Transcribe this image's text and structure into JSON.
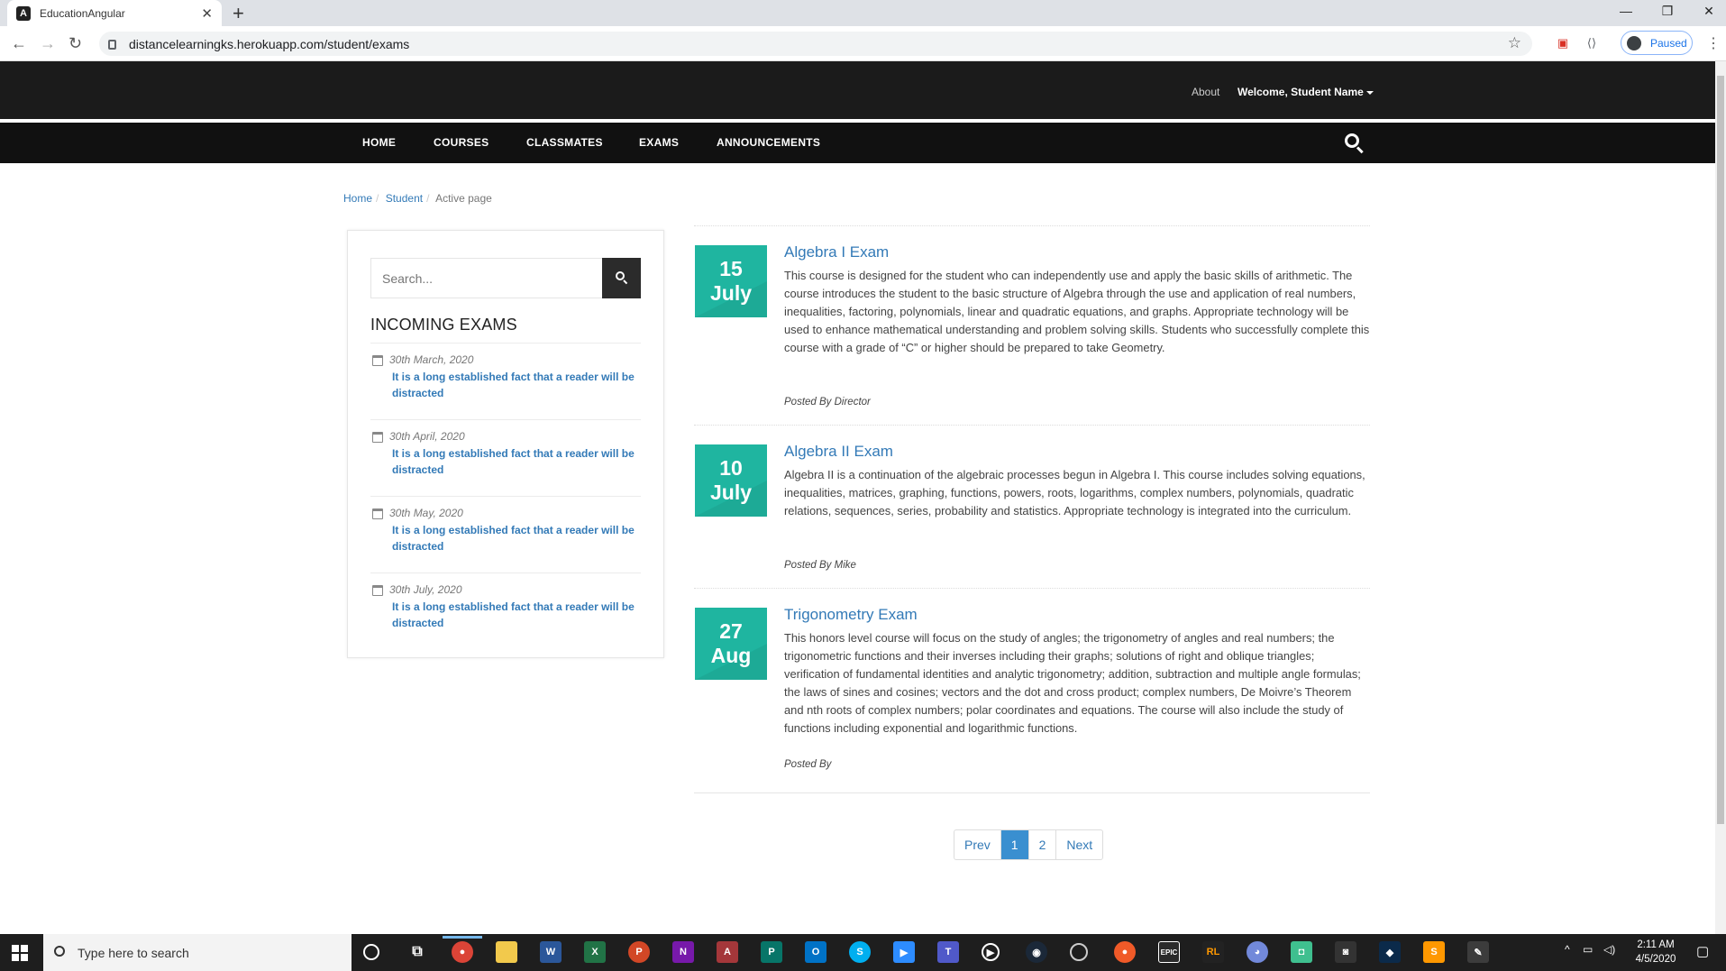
{
  "browser": {
    "tab_title": "EducationAngular",
    "favicon_letter": "A",
    "url": "distancelearningks.herokuapp.com/student/exams",
    "profile_status": "Paused"
  },
  "header": {
    "about_label": "About",
    "welcome_label": "Welcome, Student Name"
  },
  "nav": {
    "items": [
      "HOME",
      "COURSES",
      "CLASSMATES",
      "EXAMS",
      "ANNOUNCEMENTS"
    ]
  },
  "breadcrumb": {
    "home": "Home",
    "student": "Student",
    "active": "Active page"
  },
  "sidebar": {
    "search_placeholder": "Search...",
    "heading": "INCOMING EXAMS",
    "items": [
      {
        "date": "30th March, 2020",
        "text": "It is a long established fact that a reader will be distracted"
      },
      {
        "date": "30th April, 2020",
        "text": "It is a long established fact that a reader will be distracted"
      },
      {
        "date": "30th May, 2020",
        "text": "It is a long established fact that a reader will be distracted"
      },
      {
        "date": "30th July, 2020",
        "text": "It is a long established fact that a reader will be distracted"
      }
    ]
  },
  "exams": [
    {
      "day": "15",
      "month": "July",
      "title": "Algebra I Exam",
      "description": "This course is designed for the student who can independently use and apply the basic skills of arithmetic. The course introduces the student to the basic structure of Algebra through the use and application of real numbers, inequalities, factoring, polynomials, linear and quadratic equations, and graphs. Appropriate technology will be used to enhance mathematical understanding and problem solving skills. Students who successfully complete this course with a grade of “C” or higher should be prepared to take Geometry.",
      "posted_by": "Posted By Director"
    },
    {
      "day": "10",
      "month": "July",
      "title": "Algebra II Exam",
      "description": "Algebra II is a continuation of the algebraic processes begun in Algebra I. This course includes solving equations, inequalities, matrices, graphing, functions, powers, roots, logarithms, complex numbers, polynomials, quadratic relations, sequences, series, probability and statistics. Appropriate technology is integrated into the curriculum.",
      "posted_by": "Posted By Mike"
    },
    {
      "day": "27",
      "month": "Aug",
      "title": "Trigonometry Exam",
      "description": "This honors level course will focus on the study of angles; the trigonometry of angles and real numbers; the trigonometric functions and their inverses including their graphs; solutions of right and oblique triangles; verification of fundamental identities and analytic trigonometry; addition, subtraction and multiple angle formulas; the laws of sines and cosines; vectors and the dot and cross product; complex numbers, De Moivre’s Theorem and nth roots of complex numbers; polar coordinates and equations. The course will also include the study of functions including exponential and logarithmic functions.",
      "posted_by": "Posted By"
    }
  ],
  "pagination": {
    "prev": "Prev",
    "pages": [
      "1",
      "2"
    ],
    "active_page": "1",
    "next": "Next"
  },
  "taskbar": {
    "search_placeholder": "Type here to search",
    "time": "2:11 AM",
    "date": "4/5/2020"
  },
  "colors": {
    "accent_teal": "#1fb5a0",
    "link_blue": "#337ab7",
    "nav_dark": "#111111",
    "topbar_dark": "#1b1b1b"
  }
}
